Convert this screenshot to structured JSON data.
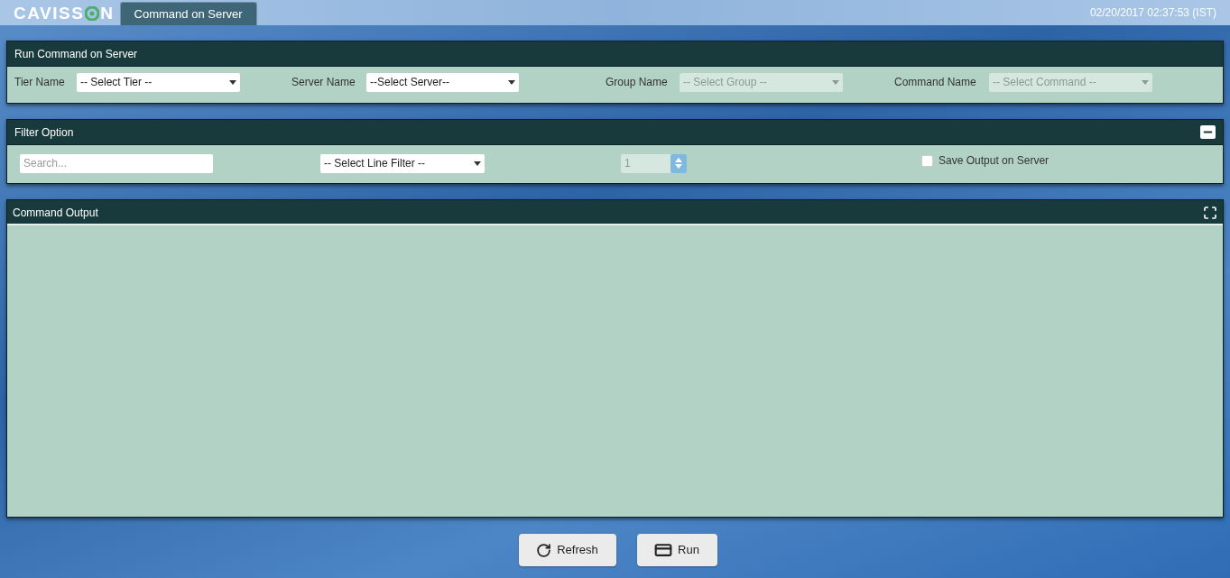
{
  "header": {
    "logo_before": "CAVISS",
    "logo_after": "N",
    "tab": {
      "label": "Command on Server",
      "selected": true
    },
    "datetime": "02/20/2017 02:37:53 (IST)"
  },
  "run_panel": {
    "title": "Run Command on Server",
    "fields": [
      {
        "label": "Tier Name",
        "value": "-- Select Tier --",
        "disabled": false
      },
      {
        "label": "Server Name",
        "value": "--Select Server--",
        "disabled": false
      },
      {
        "label": "Group Name",
        "value": "-- Select Group --",
        "disabled": true
      },
      {
        "label": "Command Name",
        "value": "-- Select Command --",
        "disabled": true
      }
    ]
  },
  "filter_panel": {
    "title": "Filter Option",
    "expanded": true,
    "search": {
      "placeholder": "Search..."
    },
    "line_filter": {
      "value": "-- Select Line Filter --",
      "disabled": false
    },
    "line_count": {
      "value": "1",
      "disabled": true
    },
    "save_output": {
      "label": "Save Output on Server",
      "checked": false
    }
  },
  "output_panel": {
    "title": "Command Output"
  },
  "buttons": [
    {
      "kind": "refresh",
      "label": "Refresh"
    },
    {
      "kind": "run",
      "label": "Run"
    }
  ]
}
